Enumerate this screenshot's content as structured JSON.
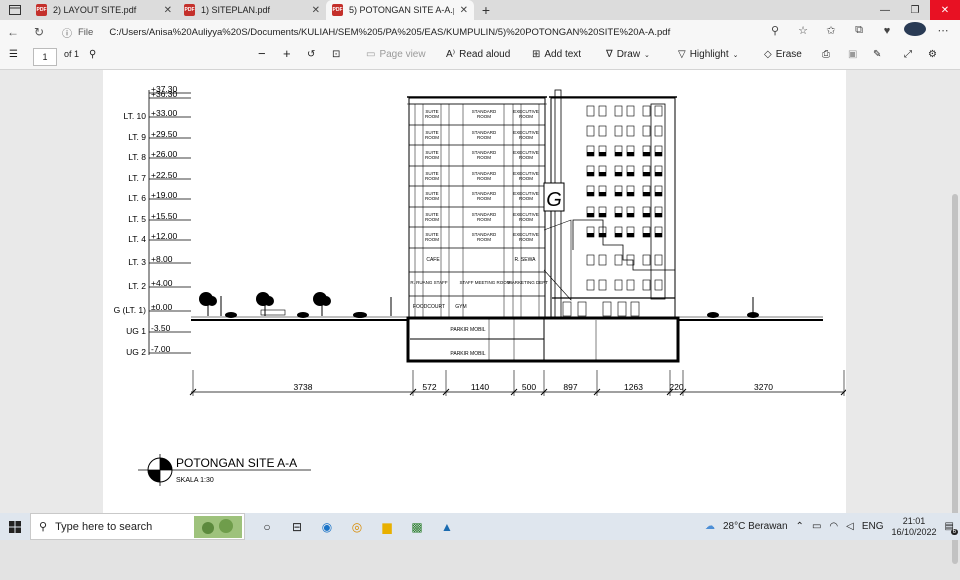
{
  "tabs": [
    {
      "label": "2) LAYOUT SITE.pdf",
      "active": false
    },
    {
      "label": "1) SITEPLAN.pdf",
      "active": false
    },
    {
      "label": "5) POTONGAN SITE A-A.pdf",
      "active": true
    }
  ],
  "address": {
    "info_label": "File",
    "url": "C:/Users/Anisa%20Auliyya%20S/Documents/KULIAH/SEM%205/PA%205/EAS/KUMPULIN/5)%20POTONGAN%20SITE%20A-A.pdf"
  },
  "pdf_toolbar": {
    "page_number": "1",
    "page_count": "of 1",
    "fit_page_label": "Fit page",
    "read_aloud_label": "Read aloud",
    "add_text_label": "Add text",
    "draw_label": "Draw",
    "highlight_label": "Highlight",
    "erase_label": "Erase"
  },
  "drawing": {
    "levels": [
      {
        "name": "",
        "elev": "+37.30"
      },
      {
        "name": "",
        "elev": "+36.30"
      },
      {
        "name": "LT. 10",
        "elev": "+33.00"
      },
      {
        "name": "LT. 9",
        "elev": "+29.50"
      },
      {
        "name": "LT. 8",
        "elev": "+26.00"
      },
      {
        "name": "LT. 7",
        "elev": "+22.50"
      },
      {
        "name": "LT. 6",
        "elev": "+19.00"
      },
      {
        "name": "LT. 5",
        "elev": "+15.50"
      },
      {
        "name": "LT. 4",
        "elev": "+12.00"
      },
      {
        "name": "LT. 3",
        "elev": "+8.00"
      },
      {
        "name": "LT. 2",
        "elev": "+4.00"
      },
      {
        "name": "G (LT. 1)",
        "elev": "±0.00"
      },
      {
        "name": "UG 1",
        "elev": "-3.50"
      },
      {
        "name": "UG 2",
        "elev": "-7.00"
      }
    ],
    "room_suite": "SUITE ROOM",
    "room_standard": "STANDARD ROOM",
    "room_executive": "EXECUTIVE ROOM",
    "room_cafe": "CAFE",
    "room_sewa": "R. SEWA",
    "room_staff": "R. RUANG STAFF",
    "room_meeting": "STAFF MEETING ROOM",
    "room_marketing": "MARKETING DEPT",
    "room_foodcourt": "FOODCOURT",
    "room_gym": "GYM",
    "room_parkir1": "PARKIR MOBIL",
    "room_parkir2": "PARKIR MOBIL",
    "logo_letter": "G",
    "dimensions": [
      "3738",
      "572",
      "1140",
      "500",
      "897",
      "1263",
      "220",
      "3270"
    ],
    "title": "POTONGAN SITE A-A",
    "scale": "SKALA 1:30"
  },
  "taskbar": {
    "search_placeholder": "Type here to search",
    "weather": "28°C Berawan",
    "lang": "ENG",
    "time": "21:01",
    "date": "16/10/2022",
    "notif_count": "6"
  }
}
